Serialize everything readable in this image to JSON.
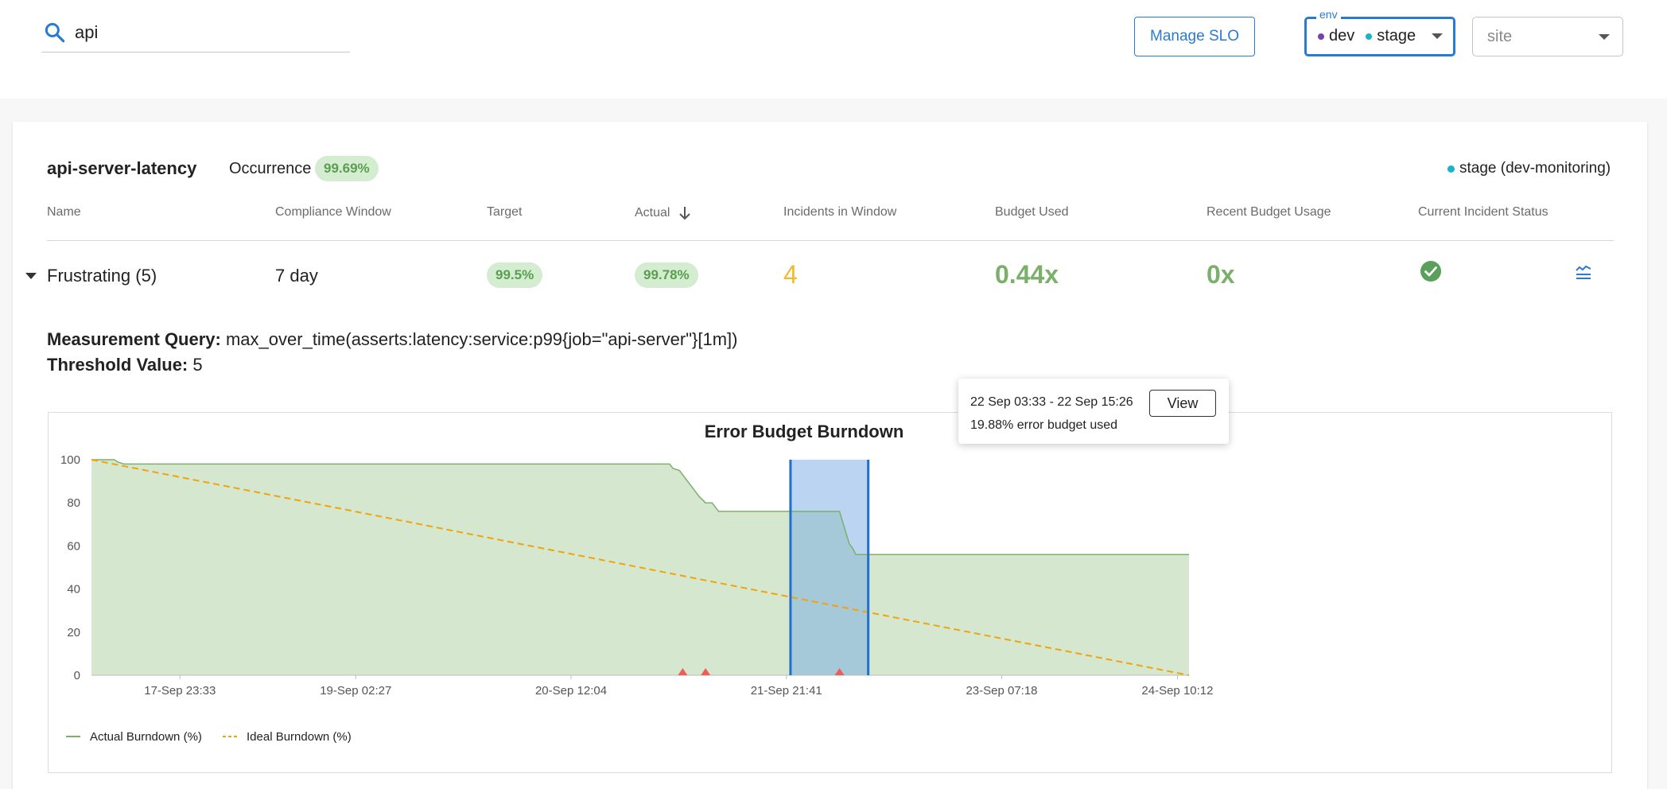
{
  "search": {
    "query": "api"
  },
  "toolbar": {
    "manage_slo_label": "Manage SLO"
  },
  "env_filter": {
    "legend": "env",
    "chips": [
      {
        "label": "dev",
        "color": "#7b3fb3"
      },
      {
        "label": "stage",
        "color": "#1ab3c7"
      }
    ]
  },
  "site_filter": {
    "placeholder": "site"
  },
  "slo": {
    "name": "api-server-latency",
    "occurrence_label": "Occurrence",
    "occurrence_value": "99.69%",
    "env_tag": "stage (dev-monitoring)",
    "env_tag_color": "#1ab3c7"
  },
  "table": {
    "headers": {
      "name": "Name",
      "window": "Compliance Window",
      "target": "Target",
      "actual": "Actual",
      "incidents": "Incidents in Window",
      "budget_used": "Budget Used",
      "recent_usage": "Recent Budget Usage",
      "incident_status": "Current Incident Status"
    },
    "row": {
      "name": "Frustrating (5)",
      "window": "7 day",
      "target": "99.5%",
      "actual": "99.78%",
      "incidents": "4",
      "budget_used": "0.44x",
      "recent_usage": "0x",
      "status": "resolved"
    }
  },
  "details": {
    "query_label": "Measurement Query:",
    "query": "max_over_time(asserts:latency:service:p99{job=\"api-server\"}[1m])",
    "threshold_label": "Threshold Value:",
    "threshold": "5"
  },
  "tooltip": {
    "range": "22 Sep 03:33 - 22 Sep 15:26",
    "used": "19.88% error budget used",
    "view_label": "View"
  },
  "chart_data": {
    "type": "area",
    "title": "Error Budget Burndown",
    "x_ticks": [
      "17-Sep 23:33",
      "19-Sep 02:27",
      "20-Sep 12:04",
      "21-Sep 21:41",
      "23-Sep 07:18",
      "24-Sep 10:12"
    ],
    "y_ticks": [
      0,
      20,
      40,
      60,
      80,
      100
    ],
    "ylim": [
      0,
      100
    ],
    "x_range_hours": [
      0,
      168
    ],
    "tick_hours": [
      13.55,
      40.45,
      73.41,
      106.37,
      139.33,
      166.23
    ],
    "series": [
      {
        "name": "Actual Burndown (%)",
        "color": "#7ab06a",
        "fill": "#d5e8cf",
        "x": [
          0,
          3.5,
          4,
          5,
          88.5,
          89,
          90,
          90.5,
          91,
          91.5,
          92,
          92.5,
          93,
          94,
          95,
          96,
          108,
          114.5,
          115,
          115.5,
          116,
          116.5,
          117,
          168
        ],
        "y": [
          100,
          100,
          99,
          98,
          98,
          96,
          95,
          93,
          91,
          89,
          87,
          85,
          83,
          80,
          80,
          76,
          76,
          76,
          71,
          66,
          61,
          59,
          56,
          56
        ]
      },
      {
        "name": "Ideal Burndown (%)",
        "color": "#f0a30a",
        "dashed": true,
        "x": [
          0,
          168
        ],
        "y": [
          100,
          0
        ]
      }
    ],
    "highlight_range_hours": [
      107,
      118.9
    ],
    "incident_markers_hours": [
      90.5,
      94,
      114.5
    ],
    "legend": "bottom-left",
    "grid": false
  }
}
